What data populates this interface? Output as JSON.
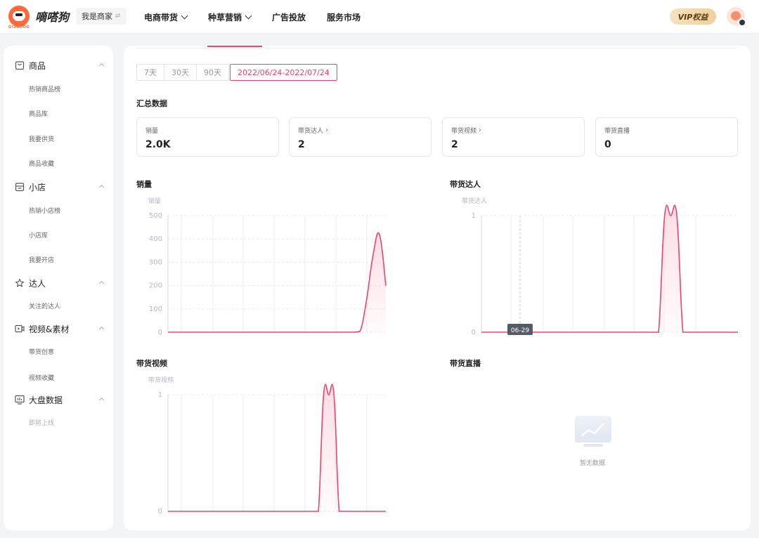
{
  "header": {
    "logo_text": "嘀嗒狗",
    "logo_sub": "DIDADOG",
    "merchant_label": "我是商家",
    "nav": [
      {
        "label": "电商带货",
        "dropdown": true
      },
      {
        "label": "种草营销",
        "dropdown": true
      },
      {
        "label": "广告投放",
        "dropdown": false
      },
      {
        "label": "服务市场",
        "dropdown": false
      }
    ],
    "vip_label": "VIP权益"
  },
  "sidebar": {
    "groups": [
      {
        "title": "商品",
        "icon": "bag-icon",
        "items": [
          "热销商品榜",
          "商品库",
          "我要供货",
          "商品收藏"
        ]
      },
      {
        "title": "小店",
        "icon": "store-icon",
        "items": [
          "热销小店榜",
          "小店库",
          "我要开店"
        ]
      },
      {
        "title": "达人",
        "icon": "star-icon",
        "items": [
          "关注的达人"
        ]
      },
      {
        "title": "视频&素材",
        "icon": "video-icon",
        "items": [
          "带货创意",
          "视频收藏"
        ]
      },
      {
        "title": "大盘数据",
        "icon": "dashboard-icon",
        "items": [
          "即将上线"
        ]
      }
    ]
  },
  "main": {
    "range_options": [
      "7天",
      "30天",
      "90天",
      "2022/06/24-2022/07/24"
    ],
    "range_selected": "2022/06/24-2022/07/24",
    "summary_title": "汇总数据",
    "cards": [
      {
        "label": "销量",
        "value": "2.0K",
        "link": false
      },
      {
        "label": "带货达人",
        "value": "2",
        "link": true
      },
      {
        "label": "带货视频",
        "value": "2",
        "link": true
      },
      {
        "label": "带货直播",
        "value": "0",
        "link": false
      }
    ],
    "charts_titles": {
      "sales": "销量",
      "influencers": "带货达人",
      "videos": "带货视频",
      "live": "带货直播"
    },
    "empty_text": "暂无数据"
  },
  "colors": {
    "accent": "#f0426a",
    "vip_bg": "#f6e2bf"
  },
  "chart_data": [
    {
      "type": "area",
      "title": "销量",
      "ylabel": "销量",
      "yticks": [
        0,
        100,
        200,
        300,
        400,
        500
      ],
      "ylim": [
        0,
        500
      ],
      "grid": true,
      "series": [
        {
          "values": [
            0,
            0,
            0,
            0,
            0,
            0,
            0,
            0,
            0,
            0,
            0,
            0,
            0,
            0,
            0,
            0,
            0,
            0,
            0,
            0,
            0,
            0,
            0,
            0,
            0,
            0,
            0,
            0,
            0,
            0,
            5,
            140,
            330,
            420,
            200
          ]
        }
      ]
    },
    {
      "type": "area",
      "title": "带货达人",
      "ylabel": "带货达人",
      "yticks": [
        0,
        1
      ],
      "ylim": [
        0,
        1
      ],
      "grid": true,
      "tooltip_x": "06-29",
      "series": [
        {
          "values": [
            0,
            0,
            0,
            0,
            0,
            0,
            0,
            0,
            0,
            0,
            0,
            0,
            0,
            0,
            0,
            0,
            0,
            0,
            0,
            0,
            0,
            0,
            0,
            0,
            0,
            0,
            0,
            0,
            0,
            0,
            1,
            1,
            1,
            0,
            0,
            0,
            0,
            0,
            0,
            0,
            0,
            0,
            0
          ]
        }
      ]
    },
    {
      "type": "area",
      "title": "带货视频",
      "ylabel": "带货视频",
      "yticks": [
        0,
        1
      ],
      "ylim": [
        0,
        1
      ],
      "grid": true,
      "series": [
        {
          "values": [
            0,
            0,
            0,
            0,
            0,
            0,
            0,
            0,
            0,
            0,
            0,
            0,
            0,
            0,
            0,
            0,
            0,
            0,
            0,
            0,
            0,
            0,
            0,
            0,
            0,
            0,
            0,
            0,
            0,
            0,
            1,
            1,
            1,
            0,
            0,
            0,
            0,
            0,
            0,
            0,
            0,
            0,
            0
          ]
        }
      ]
    }
  ]
}
